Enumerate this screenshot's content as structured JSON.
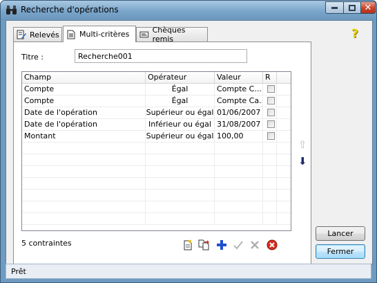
{
  "window": {
    "title": "Recherche d'opérations",
    "close_glyph": "✕"
  },
  "tabs": [
    {
      "label": "Relevés",
      "icon": "edit-document-icon"
    },
    {
      "label": "Multi-critères",
      "icon": "document-icon"
    },
    {
      "label": "Chèques remis",
      "icon": "cheque-icon"
    }
  ],
  "help_glyph": "?",
  "form": {
    "titre_label": "Titre :",
    "titre_value": "Recherche001"
  },
  "grid": {
    "columns": [
      "Champ",
      "Opérateur",
      "Valeur",
      "R"
    ],
    "rows": [
      {
        "champ": "Compte",
        "operateur": "Égal",
        "valeur": "Compte C..."
      },
      {
        "champ": "Compte",
        "operateur": "Égal",
        "valeur": "Compte Ca..."
      },
      {
        "champ": "Date de l'opération",
        "operateur": "Supérieur ou égal",
        "valeur": "01/06/2007"
      },
      {
        "champ": "Date de l'opération",
        "operateur": "Inférieur ou égal",
        "valeur": "31/08/2007"
      },
      {
        "champ": "Montant",
        "operateur": "Supérieur ou égal",
        "valeur": "100,00"
      }
    ]
  },
  "count_label": "5 contraintes",
  "buttons": {
    "lancer": "Lancer",
    "fermer": "Fermer"
  },
  "status": "Prêt",
  "colors": {
    "accent": "#1c2a6a",
    "add": "#1f4fd1",
    "delete": "#d62b1f",
    "help": "#e8d30a"
  }
}
